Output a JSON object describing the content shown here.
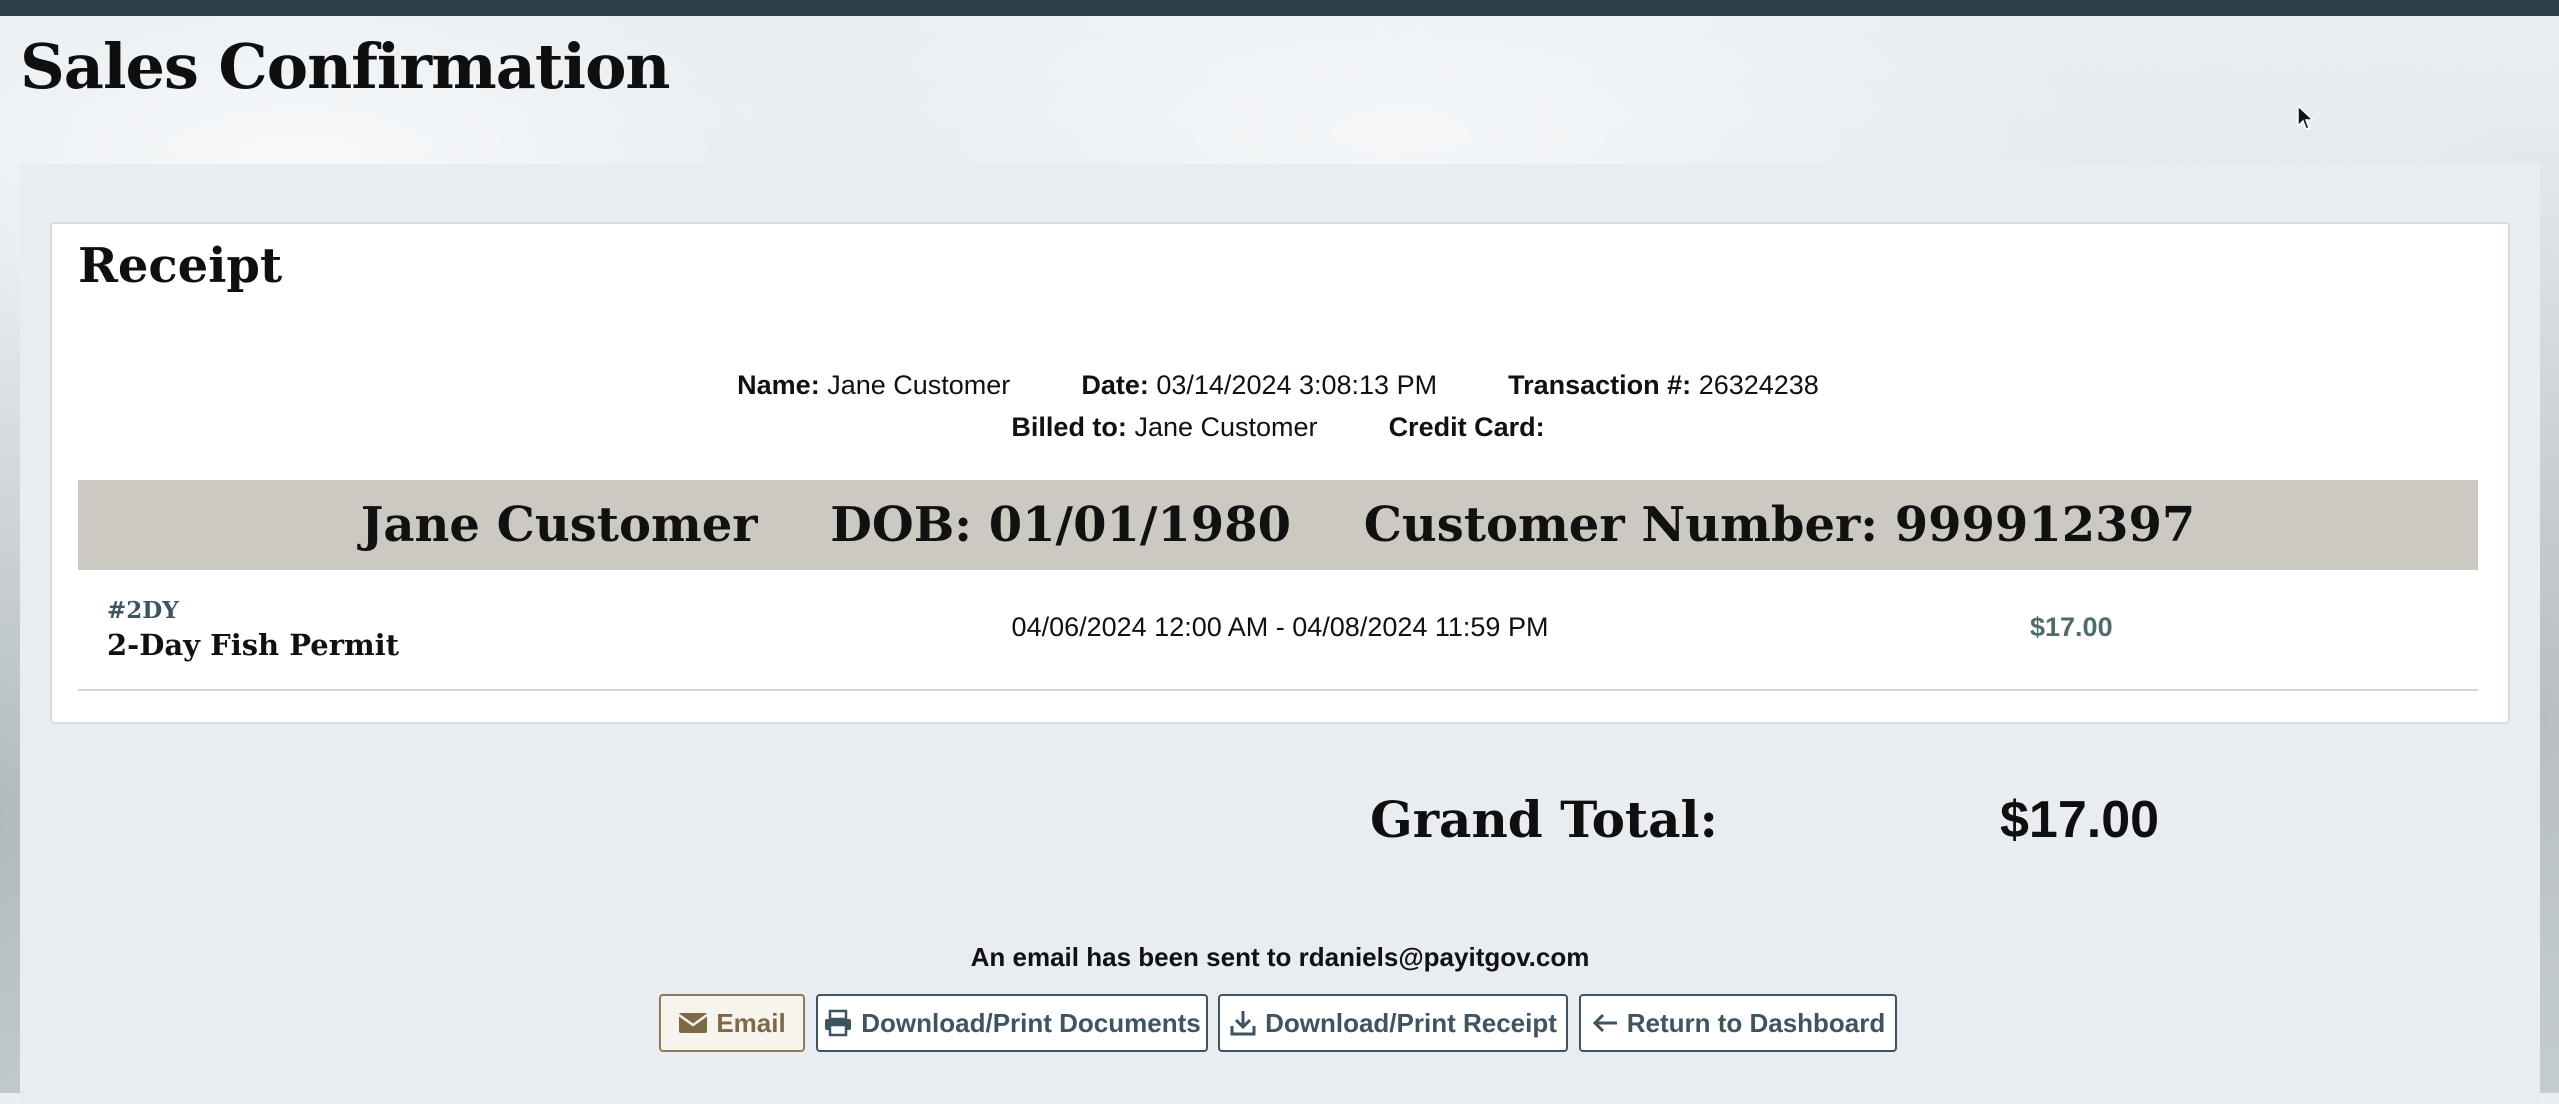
{
  "page": {
    "title": "Sales Confirmation"
  },
  "receipt": {
    "title": "Receipt",
    "name_label": "Name:",
    "name": "Jane Customer",
    "date_label": "Date:",
    "date": "03/14/2024 3:08:13 PM",
    "transaction_label": "Transaction #:",
    "transaction": "26324238",
    "billed_label": "Billed to:",
    "billed_to": "Jane Customer",
    "card_label": "Credit Card:",
    "credit_card": ""
  },
  "customer": {
    "name": "Jane Customer",
    "dob": "DOB: 01/01/1980",
    "number": "Customer Number: 999912397"
  },
  "items": [
    {
      "code": "#2DY",
      "name": "2-Day Fish Permit",
      "dates": "04/06/2024 12:00 AM - 04/08/2024 11:59 PM",
      "price": "$17.00"
    }
  ],
  "totals": {
    "label": "Grand Total:",
    "value": "$17.00"
  },
  "email_note": "An email has been sent to rdaniels@payitgov.com",
  "actions": {
    "email": "Email",
    "docs": "Download/Print Documents",
    "receipt": "Download/Print Receipt",
    "dashboard": "Return to Dashboard"
  },
  "colors": {
    "accent": "#3d5561",
    "email_button": "#7b6a45",
    "band": "#ccc9c3",
    "topbar": "#2c4149",
    "price": "#4d6d6d"
  }
}
